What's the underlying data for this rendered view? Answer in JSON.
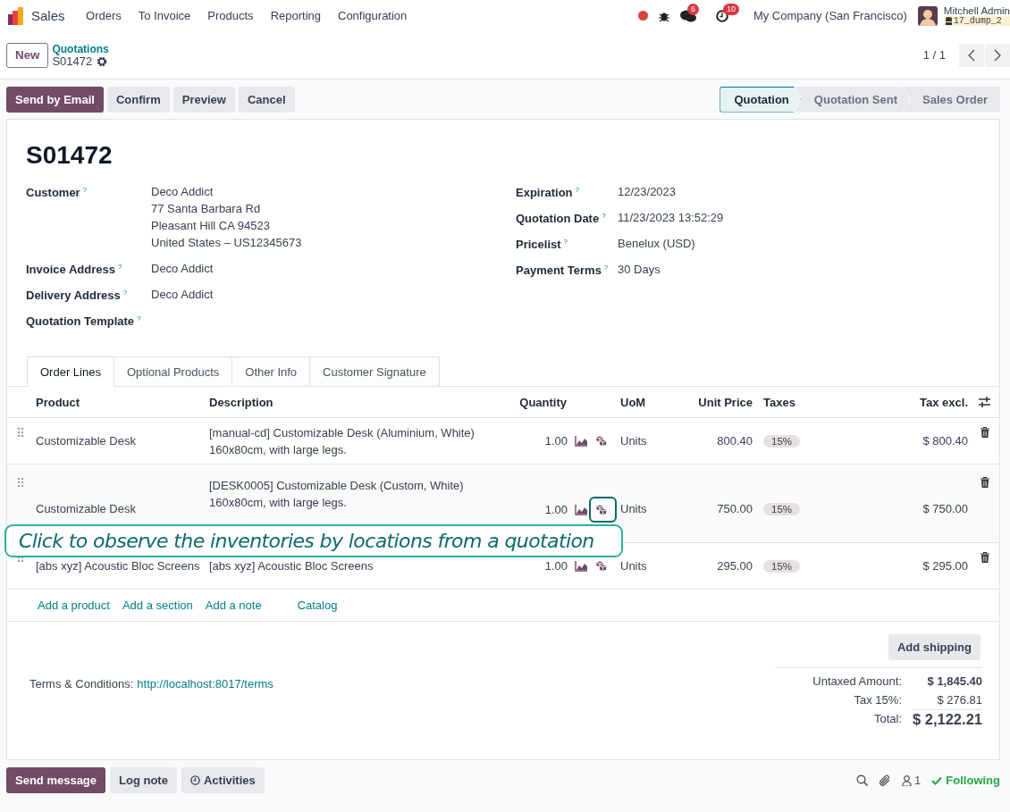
{
  "navbar": {
    "app_name": "Sales",
    "menu": [
      "Orders",
      "To Invoice",
      "Products",
      "Reporting",
      "Configuration"
    ],
    "messages_count": "6",
    "activities_count": "10",
    "company": "My Company (San Francisco)",
    "user_name": "Mitchell Admin",
    "database": "17_dump_2"
  },
  "breadcrumb": {
    "new_button": "New",
    "parent": "Quotations",
    "current": "S01472"
  },
  "pager": "1 / 1",
  "actions": [
    {
      "label": "Send by Email",
      "primary": true
    },
    {
      "label": "Confirm",
      "primary": false
    },
    {
      "label": "Preview",
      "primary": false
    },
    {
      "label": "Cancel",
      "primary": false
    }
  ],
  "status_stages": [
    {
      "label": "Quotation",
      "selected": true
    },
    {
      "label": "Quotation Sent",
      "selected": false
    },
    {
      "label": "Sales Order",
      "selected": false
    }
  ],
  "record": {
    "title": "S01472",
    "left_fields": [
      {
        "label": "Customer",
        "help": "?",
        "value": "Deco Addict\n77 Santa Barbara Rd\nPleasant Hill CA 94523\nUnited States – US12345673"
      },
      {
        "label": "Invoice Address",
        "help": "?",
        "value": "Deco Addict"
      },
      {
        "label": "Delivery Address",
        "help": "?",
        "value": "Deco Addict"
      },
      {
        "label": "Quotation Template",
        "help": "?"
      }
    ],
    "right_fields": [
      {
        "label": "Expiration",
        "help": "?",
        "value": "12/23/2023"
      },
      {
        "label": "Quotation Date",
        "help": "?",
        "value": "11/23/2023 13:52:29"
      },
      {
        "label": "Pricelist",
        "help": "?",
        "value": "Benelux (USD)"
      },
      {
        "label": "Payment Terms",
        "help": "?",
        "value": "30 Days"
      }
    ]
  },
  "tabs": [
    {
      "label": "Order Lines",
      "selected": true
    },
    {
      "label": "Optional Products",
      "selected": false
    },
    {
      "label": "Other Info",
      "selected": false
    },
    {
      "label": "Customer Signature",
      "selected": false
    }
  ],
  "order_lines": {
    "columns": [
      "Product",
      "Description",
      "Quantity",
      "UoM",
      "Unit Price",
      "Taxes",
      "Tax excl."
    ],
    "rows": [
      {
        "product": "Customizable Desk",
        "description": "[manual-cd] Customizable Desk (Aluminium, White)\n160x80cm, with large legs.",
        "quantity": "1.00",
        "uom": "Units",
        "unit_price": "800.40",
        "tax": "15%",
        "subtotal": "$ 800.40",
        "selected": false,
        "highlighted": false
      },
      {
        "product": "Customizable Desk",
        "description": "[DESK0005] Customizable Desk (Custom, White)\n160x80cm, with large legs.",
        "quantity": "1.00",
        "uom": "Units",
        "unit_price": "750.00",
        "tax": "15%",
        "subtotal": "$ 750.00",
        "selected": true,
        "highlighted": true
      },
      {
        "product": "[abs xyz] Acoustic Bloc Screens",
        "description": "[abs xyz] Acoustic Bloc Screens",
        "quantity": "1.00",
        "uom": "Units",
        "unit_price": "295.00",
        "tax": "15%",
        "subtotal": "$ 295.00",
        "selected": false,
        "highlighted": false
      }
    ],
    "add_links": [
      "Add a product",
      "Add a section",
      "Add a note",
      "Catalog"
    ]
  },
  "add_shipping": "Add shipping",
  "terms": {
    "label": "Terms & Conditions:",
    "link": "http://localhost:8017/terms"
  },
  "totals": [
    {
      "label": "Untaxed Amount:",
      "value": "$ 1,845.40",
      "kind": "subtotal"
    },
    {
      "label": "Tax 15%:",
      "value": "$ 276.81",
      "kind": "tax"
    },
    {
      "label": "Total:",
      "value": "$ 2,122.21",
      "kind": "total"
    }
  ],
  "chatter": {
    "buttons": [
      {
        "label": "Send message",
        "primary": true,
        "kind": "plain"
      },
      {
        "label": "Log note",
        "primary": false,
        "kind": "plain"
      },
      {
        "label": "Activities",
        "primary": false,
        "kind": "activities"
      }
    ],
    "followers_count": "1",
    "follow_label": "Following"
  },
  "guide_tip": "Click to observe the inventories by locations from a quotation"
}
